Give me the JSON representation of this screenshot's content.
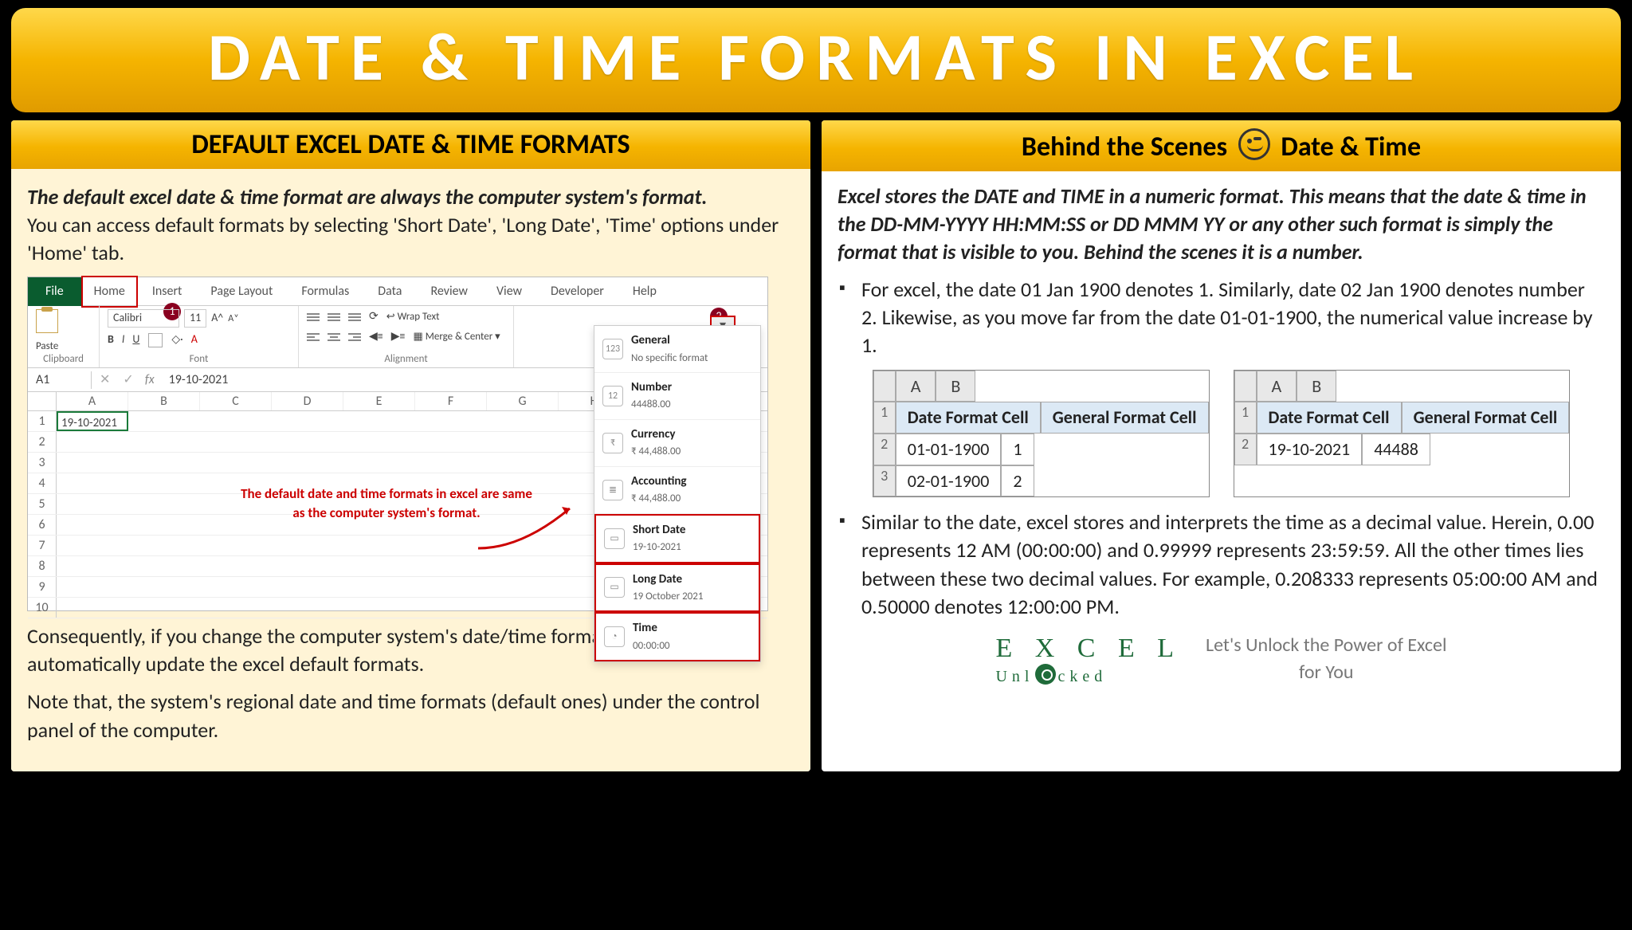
{
  "banner_title": "DATE & TIME FORMATS IN EXCEL",
  "left": {
    "header": "DEFAULT EXCEL DATE & TIME FORMATS",
    "intro_bold": "The default excel date & time format are always the computer system's format.",
    "intro_rest": "You can access default formats by selecting 'Short Date', 'Long Date', 'Time' options under 'Home' tab.",
    "para_after1": "Consequently, if you change the computer system's date/time formats, it would automatically update the excel default formats.",
    "para_after2": "Note that, the system's regional date and time formats (default ones) under the control panel of the computer.",
    "excel": {
      "tabs": [
        "File",
        "Home",
        "Insert",
        "Page Layout",
        "Formulas",
        "Data",
        "Review",
        "View",
        "Developer",
        "Help"
      ],
      "callout1": "1",
      "callout2": "2",
      "groups": {
        "clipboard": "Clipboard",
        "paste": "Paste",
        "font": "Font",
        "alignment": "Alignment",
        "font_name": "Calibri",
        "font_size": "11",
        "wrap": "Wrap Text",
        "merge": "Merge & Center"
      },
      "namebox": "A1",
      "formula": "19-10-2021",
      "col_headers": [
        "A",
        "B",
        "C",
        "D",
        "E",
        "F",
        "G",
        "H"
      ],
      "cell_a1": "19-10-2021",
      "red_text": "The default date and time formats in excel are same as the computer system's format.",
      "dropdown": [
        {
          "title": "General",
          "sub": "No specific format",
          "ico": "123"
        },
        {
          "title": "Number",
          "sub": "44488.00",
          "ico": "12"
        },
        {
          "title": "Currency",
          "sub": "₹ 44,488.00",
          "ico": "₹"
        },
        {
          "title": "Accounting",
          "sub": "₹ 44,488.00",
          "ico": "≣"
        },
        {
          "title": "Short Date",
          "sub": "19-10-2021",
          "ico": "▭",
          "hl": true
        },
        {
          "title": "Long Date",
          "sub": "19 October 2021",
          "ico": "▭",
          "hl": true
        },
        {
          "title": "Time",
          "sub": "00:00:00",
          "ico": "◔",
          "hl": true
        }
      ]
    }
  },
  "right": {
    "header_a": "Behind the Scenes",
    "header_b": "Date & Time",
    "intro": "Excel stores the DATE and TIME in a numeric format. This means that the date & time in the DD-MM-YYYY HH:MM:SS or DD MMM YY or any other such format is simply the format that is visible to you. Behind the scenes it is a number.",
    "bullet1": "For excel, the date 01 Jan 1900 denotes 1. Similarly, date 02 Jan 1900 denotes number 2. Likewise, as you move far from the date 01-01-1900, the numerical value increase by 1.",
    "bullet2": "Similar to the date, excel stores and interprets the time as a decimal value. Herein, 0.00 represents 12 AM (00:00:00) and 0.99999 represents 23:59:59. All the other times lies between these two decimal values. For example, 0.208333 represents 05:00:00 AM and 0.50000 denotes 12:00:00 PM.",
    "table_headers": {
      "a": "Date Format Cell",
      "b": "General Format Cell",
      "colA": "A",
      "colB": "B"
    },
    "table1": [
      {
        "n": "1",
        "a": "",
        "b": ""
      },
      {
        "n": "2",
        "a": "01-01-1900",
        "b": "1"
      },
      {
        "n": "3",
        "a": "02-01-1900",
        "b": "2"
      }
    ],
    "table2": [
      {
        "n": "1",
        "a": "",
        "b": ""
      },
      {
        "n": "2",
        "a": "19-10-2021",
        "b": "44488"
      }
    ],
    "logo": {
      "top": "E X C E L",
      "bot": "Unl   cked"
    },
    "tagline1": "Let's Unlock the Power of Excel",
    "tagline2": "for You"
  }
}
